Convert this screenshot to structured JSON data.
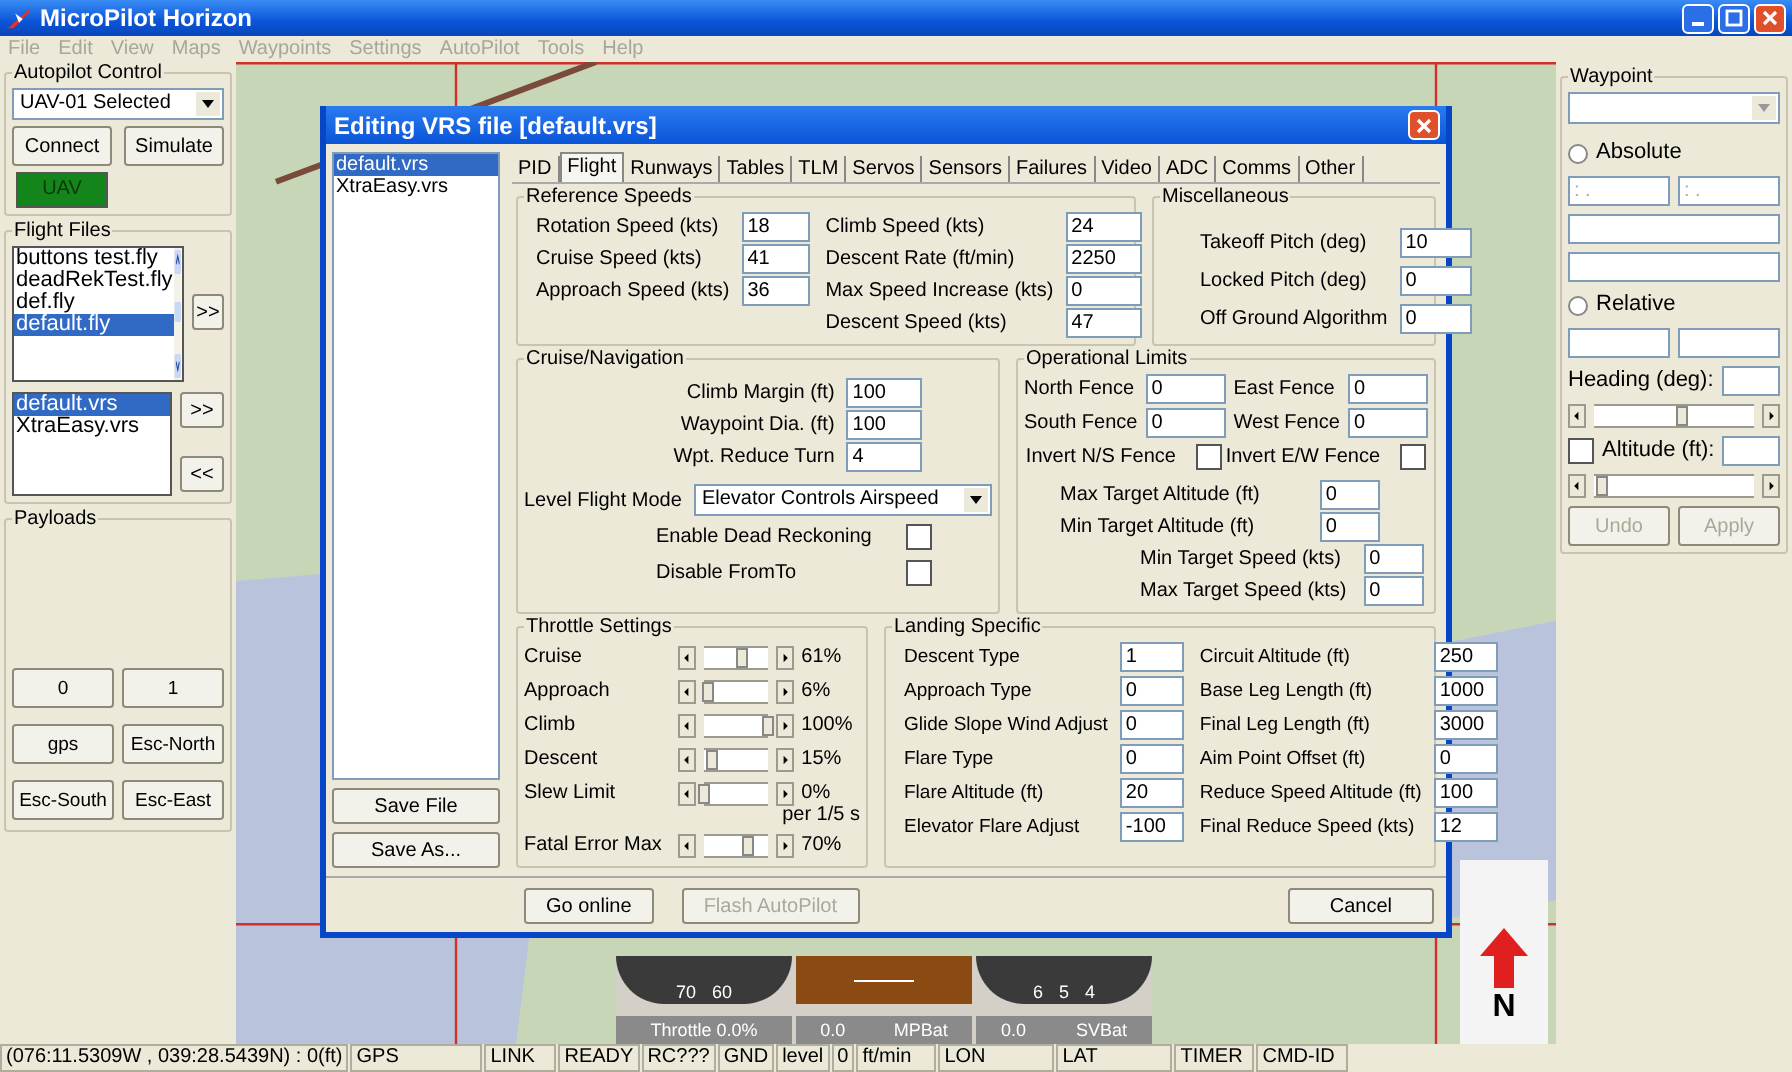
{
  "window": {
    "title": "MicroPilot Horizon"
  },
  "menu": [
    {
      "label": "File",
      "disabled": true
    },
    {
      "label": "Edit",
      "disabled": true
    },
    {
      "label": "View",
      "disabled": true
    },
    {
      "label": "Maps",
      "disabled": true
    },
    {
      "label": "Waypoints",
      "disabled": true
    },
    {
      "label": "Settings",
      "disabled": true
    },
    {
      "label": "AutoPilot",
      "disabled": true
    },
    {
      "label": "Tools",
      "disabled": true
    },
    {
      "label": "Help",
      "disabled": true
    }
  ],
  "autopilot_control": {
    "title": "Autopilot Control",
    "uav_select": "UAV-01 Selected",
    "buttons": [
      "Connect",
      "Simulate"
    ],
    "status": {
      "label": "UAV",
      "on": true
    }
  },
  "flight_files": {
    "title": "Flight Files",
    "fly_files": [
      {
        "name": "buttons test.fly",
        "selected": false
      },
      {
        "name": "deadRekTest.fly",
        "selected": false
      },
      {
        "name": "def.fly",
        "selected": false
      },
      {
        "name": "default.fly",
        "selected": true
      }
    ],
    "fly_button": ">>",
    "vrs_files": [
      {
        "name": "default.vrs",
        "selected": true
      },
      {
        "name": "XtraEasy.vrs",
        "selected": false
      }
    ],
    "vrs_buttons": [
      ">>",
      "<<"
    ]
  },
  "payloads": {
    "title": "Payloads",
    "buttons": [
      "0",
      "1",
      "gps",
      "Esc-North",
      "Esc-South",
      "Esc-East"
    ]
  },
  "dialog": {
    "title": "Editing VRS file [default.vrs]",
    "files": [
      {
        "name": "default.vrs",
        "selected": true
      },
      {
        "name": "XtraEasy.vrs",
        "selected": false
      }
    ],
    "file_buttons": [
      "Save File",
      "Save As..."
    ],
    "tabs": [
      {
        "label": "PID",
        "selected": false
      },
      {
        "label": "Flight",
        "selected": true
      },
      {
        "label": "Runways",
        "selected": false
      },
      {
        "label": "Tables",
        "selected": false
      },
      {
        "label": "TLM",
        "selected": false
      },
      {
        "label": "Servos",
        "selected": false
      },
      {
        "label": "Sensors",
        "selected": false
      },
      {
        "label": "Failures",
        "selected": false
      },
      {
        "label": "Video",
        "selected": false
      },
      {
        "label": "ADC",
        "selected": false
      },
      {
        "label": "Comms",
        "selected": false
      },
      {
        "label": "Other",
        "selected": false
      }
    ],
    "reference_speeds": {
      "title": "Reference Speeds",
      "left": [
        {
          "label": "Rotation Speed (kts)",
          "value": "18"
        },
        {
          "label": "Cruise Speed (kts)",
          "value": "41"
        },
        {
          "label": "Approach Speed (kts)",
          "value": "36"
        }
      ],
      "right": [
        {
          "label": "Climb Speed (kts)",
          "value": "24"
        },
        {
          "label": "Descent Rate (ft/min)",
          "value": "2250"
        },
        {
          "label": "Max Speed Increase (kts)",
          "value": "0"
        },
        {
          "label": "Descent Speed (kts)",
          "value": "47"
        }
      ]
    },
    "miscellaneous": {
      "title": "Miscellaneous",
      "fields": [
        {
          "label": "Takeoff Pitch (deg)",
          "value": "10"
        },
        {
          "label": "Locked Pitch (deg)",
          "value": "0"
        },
        {
          "label": "Off Ground Algorithm",
          "value": "0"
        }
      ]
    },
    "cruise_navigation": {
      "title": "Cruise/Navigation",
      "fields": [
        {
          "label": "Climb Margin (ft)",
          "value": "100"
        },
        {
          "label": "Waypoint Dia. (ft)",
          "value": "100"
        },
        {
          "label": "Wpt. Reduce Turn",
          "value": "4"
        }
      ],
      "mode": {
        "label": "Level Flight Mode",
        "value": "Elevator Controls Airspeed"
      },
      "options": [
        {
          "label": "Enable Dead Reckoning",
          "checked": false
        },
        {
          "label": "Disable FromTo",
          "checked": false
        }
      ]
    },
    "operational_limits": {
      "title": "Operational Limits",
      "fences": [
        {
          "label": "North Fence",
          "value": "0"
        },
        {
          "label": "East Fence",
          "value": "0"
        },
        {
          "label": "South Fence",
          "value": "0"
        },
        {
          "label": "West Fence",
          "value": "0"
        }
      ],
      "inverts": [
        {
          "label": "Invert N/S Fence",
          "checked": false
        },
        {
          "label": "Invert E/W Fence",
          "checked": false
        }
      ],
      "altitude_targets": [
        {
          "label": "Max Target Altitude (ft)",
          "value": "0"
        },
        {
          "label": "Min Target Altitude (ft)",
          "value": "0"
        }
      ],
      "speed_targets": [
        {
          "label": "Min Target Speed (kts)",
          "value": "0"
        },
        {
          "label": "Max Target Speed (kts)",
          "value": "0"
        }
      ]
    },
    "throttle": {
      "title": "Throttle Settings",
      "rows": [
        {
          "label": "Cruise",
          "level": 0.61,
          "reading": "61%"
        },
        {
          "label": "Approach",
          "level": 0.06,
          "reading": "6%"
        },
        {
          "label": "Climb",
          "level": 1,
          "reading": "100%"
        },
        {
          "label": "Descent",
          "level": 0.15,
          "reading": "15%"
        },
        {
          "label": "Slew Limit",
          "level": 0,
          "reading": "0%",
          "note": "per 1/5 s"
        },
        {
          "label": "Fatal Error Max",
          "level": 0.7,
          "reading": "70%"
        }
      ]
    },
    "landing": {
      "title": "Landing Specific",
      "left": [
        {
          "label": "Descent Type",
          "value": "1"
        },
        {
          "label": "Approach Type",
          "value": "0"
        },
        {
          "label": "Glide Slope Wind Adjust",
          "value": "0"
        },
        {
          "label": "Flare Type",
          "value": "0"
        },
        {
          "label": "Flare Altitude (ft)",
          "value": "20"
        },
        {
          "label": "Elevator Flare Adjust",
          "value": "-100"
        }
      ],
      "right": [
        {
          "label": "Circuit Altitude (ft)",
          "value": "250"
        },
        {
          "label": "Base Leg Length (ft)",
          "value": "1000"
        },
        {
          "label": "Final Leg Length (ft)",
          "value": "3000"
        },
        {
          "label": "Aim Point Offset (ft)",
          "value": "0"
        },
        {
          "label": "Reduce Speed Altitude (ft)",
          "value": "100"
        },
        {
          "label": "Final Reduce Speed (kts)",
          "value": "12"
        }
      ]
    },
    "buttons": [
      {
        "label": "Go online",
        "disabled": false
      },
      {
        "label": "Flash AutoPilot",
        "disabled": true
      },
      {
        "label": "Cancel",
        "disabled": false
      }
    ]
  },
  "instruments": {
    "dials": [
      {
        "kind": "dial",
        "numbers": [
          "70",
          "60"
        ]
      },
      {
        "kind": "horizon"
      },
      {
        "kind": "dial",
        "numbers": [
          "6",
          "5",
          "4"
        ]
      }
    ],
    "bars": [
      {
        "label": "Throttle 0.0%"
      },
      {
        "value": "0.0",
        "label": "MPBat"
      },
      {
        "value": "0.0",
        "label": "SVBat"
      }
    ]
  },
  "compass": {
    "label": "N"
  },
  "waypoint": {
    "title": "Waypoint",
    "modes": [
      {
        "label": "Absolute",
        "selected": false
      },
      {
        "label": "Relative",
        "selected": false
      }
    ],
    "absolute_fields": [
      ": .",
      ": ."
    ],
    "heading": {
      "label": "Heading (deg):",
      "level": 0.55
    },
    "altitude": {
      "label": "Altitude (ft):",
      "checked": false,
      "level": 0.05
    },
    "buttons": [
      {
        "label": "Undo",
        "disabled": true
      },
      {
        "label": "Apply",
        "disabled": true
      }
    ]
  },
  "status_bar": [
    "(076:11.5309W , 039:28.5439N) : 0(ft)",
    "GPS",
    "LINK",
    "READY",
    "RC???",
    "GND",
    "level",
    "0",
    "ft/min",
    "LON",
    "LAT",
    "TIMER",
    "CMD-ID"
  ]
}
